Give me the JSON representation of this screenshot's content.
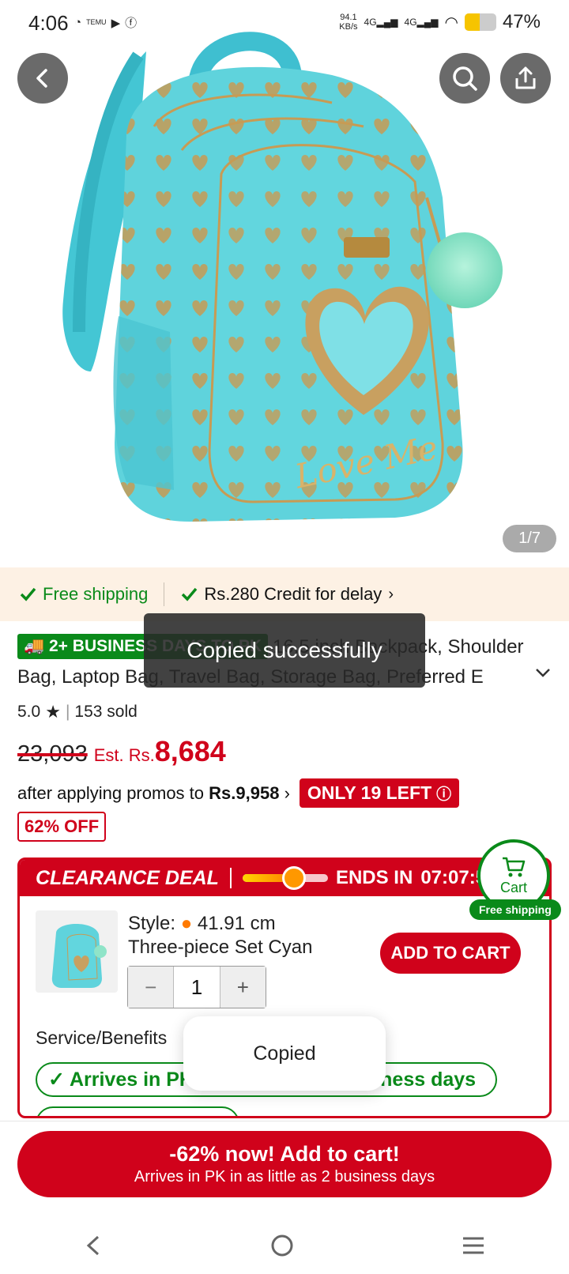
{
  "status_bar": {
    "time": "4:06",
    "notif_app_label": "TEMU",
    "net_speed": "94.1",
    "net_unit": "KB/s",
    "sig1": "4G",
    "sig2": "4G",
    "battery_text": "47%",
    "battery_level": 0.47,
    "battery_color": "#f6c400"
  },
  "hero": {
    "image_counter": "1/7",
    "embroidery_text": "Love Me"
  },
  "shipping_strip": {
    "free_shipping": "Free shipping",
    "credit": "Rs.280 Credit for delay"
  },
  "product": {
    "badge": "2+ BUSINESS DAYS TO PK",
    "title": "16.5 inch Backpack, Shoulder Bag, Laptop Bag, Travel Bag, Storage Bag, Preferred E",
    "rating": "5.0",
    "sold": "153 sold",
    "old_price": "23,093",
    "est_label": "Est. Rs.",
    "price": "8,684",
    "promo_prefix": "after applying promos to",
    "promo_price": "Rs.9,958",
    "stock_badge": "ONLY 19 LEFT",
    "discount_badge": "62% OFF"
  },
  "clearance": {
    "label": "CLEARANCE DEAL",
    "ends_label": "ENDS IN",
    "countdown": "07:07:5",
    "progress": 0.6,
    "style_label": "Style:",
    "style_size": "41.91 cm",
    "style_variant": "Three-piece Set Cyan",
    "quantity": "1",
    "add_to_cart": "ADD TO CART",
    "services_label": "Service/Benefits",
    "arrives": "Arrives in PK in as little as 2 business days"
  },
  "floating_cart": {
    "label": "Cart",
    "free_shipping": "Free shipping"
  },
  "bottom_cta": {
    "line1": "-62% now! Add to cart!",
    "line2": "Arrives in PK in as little as 2 business days"
  },
  "toasts": {
    "top": "Copied successfully",
    "bottom": "Copied"
  },
  "colors": {
    "accent_red": "#d0021b",
    "accent_green": "#0a8a1a",
    "product_teal": "#5fd3dc"
  }
}
